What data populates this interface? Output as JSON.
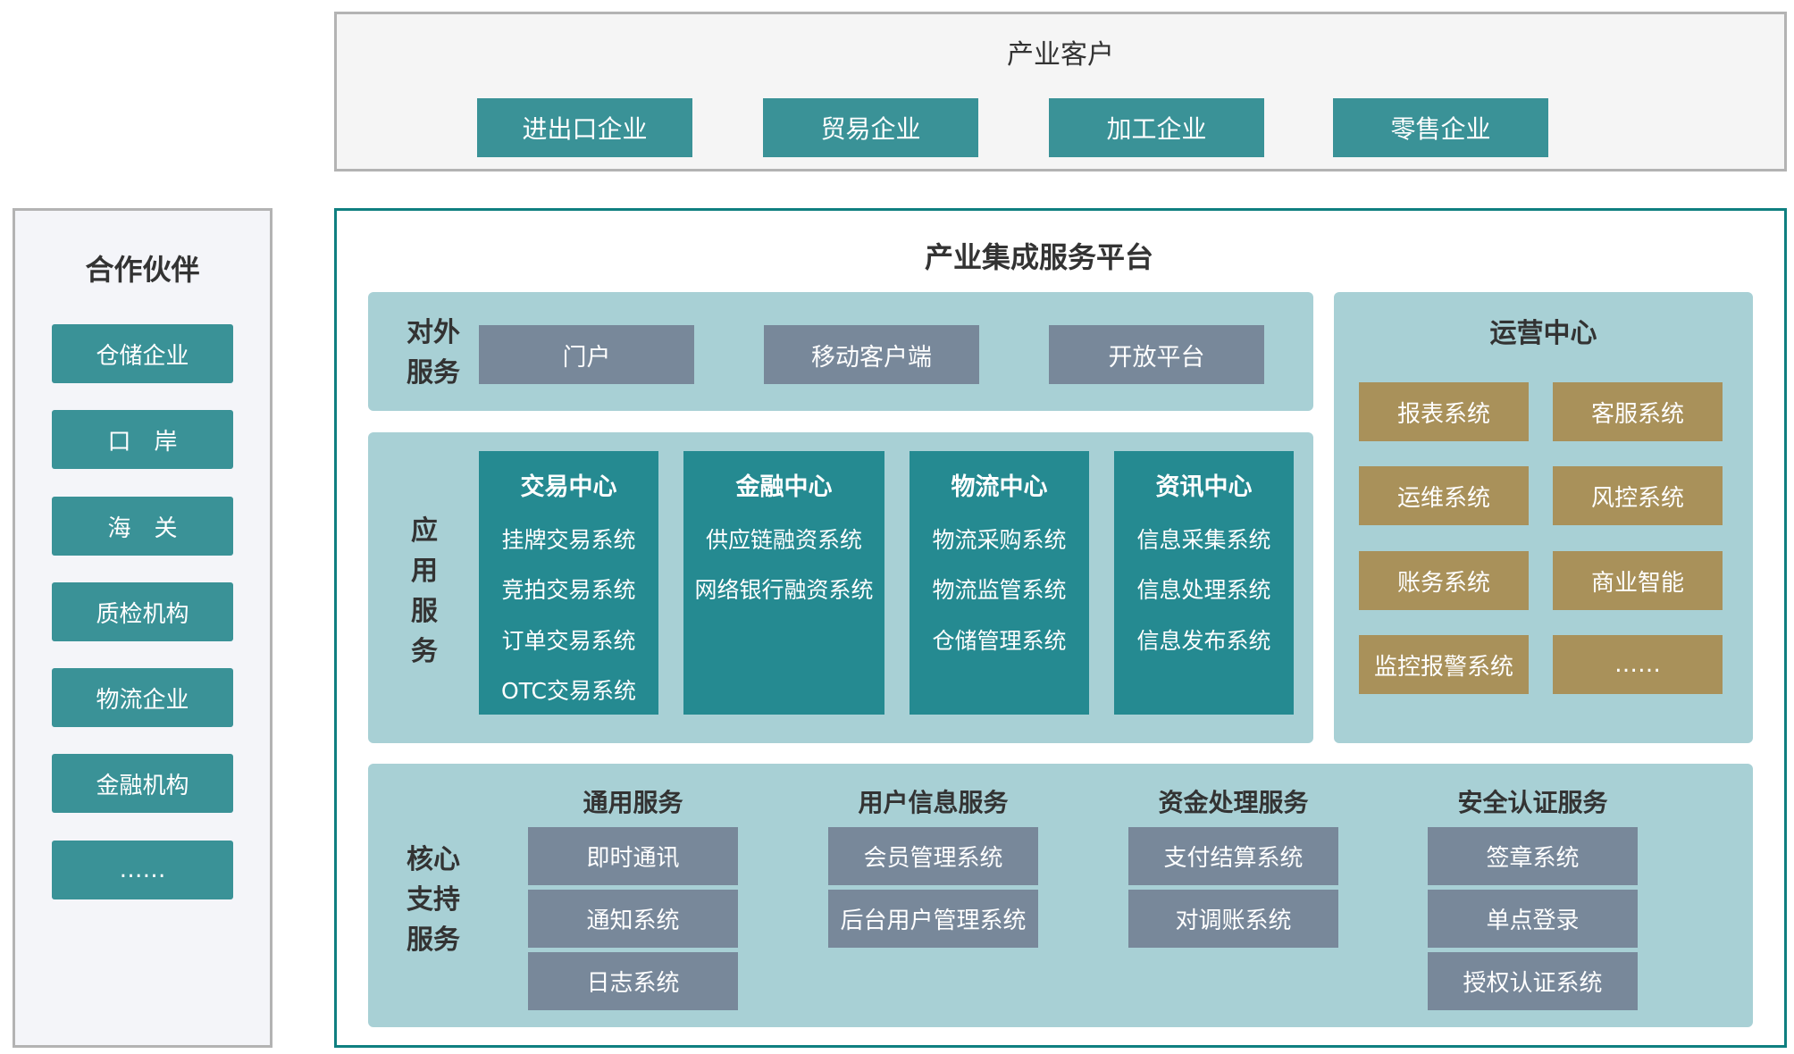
{
  "customers": {
    "title": "产业客户",
    "items": [
      "进出口企业",
      "贸易企业",
      "加工企业",
      "零售企业"
    ]
  },
  "partners": {
    "title": "合作伙伴",
    "items": [
      "仓储企业",
      "口　岸",
      "海　关",
      "质检机构",
      "物流企业",
      "金融机构",
      "……"
    ]
  },
  "platform": {
    "title": "产业集成服务平台",
    "external": {
      "label_line1": "对外",
      "label_line2": "服务",
      "items": [
        "门户",
        "移动客户端",
        "开放平台"
      ]
    },
    "application": {
      "label": [
        "应",
        "用",
        "服",
        "务"
      ],
      "centers": [
        {
          "title": "交易中心",
          "items": [
            "挂牌交易系统",
            "竞拍交易系统",
            "订单交易系统",
            "OTC交易系统"
          ]
        },
        {
          "title": "金融中心",
          "items": [
            "供应链融资系统",
            "网络银行融资系统"
          ]
        },
        {
          "title": "物流中心",
          "items": [
            "物流采购系统",
            "物流监管系统",
            "仓储管理系统"
          ]
        },
        {
          "title": "资讯中心",
          "items": [
            "信息采集系统",
            "信息处理系统",
            "信息发布系统"
          ]
        }
      ]
    },
    "operations": {
      "title": "运营中心",
      "items": [
        "报表系统",
        "客服系统",
        "运维系统",
        "风控系统",
        "账务系统",
        "商业智能",
        "监控报警系统",
        "……"
      ]
    },
    "core": {
      "label": [
        "核心",
        "支持",
        "服务"
      ],
      "groups": [
        {
          "title": "通用服务",
          "items": [
            "即时通讯",
            "通知系统",
            "日志系统"
          ]
        },
        {
          "title": "用户信息服务",
          "items": [
            "会员管理系统",
            "后台用户管理系统"
          ]
        },
        {
          "title": "资金处理服务",
          "items": [
            "支付结算系统",
            "对调账系统"
          ]
        },
        {
          "title": "安全认证服务",
          "items": [
            "签章系统",
            "单点登录",
            "授权认证系统"
          ]
        }
      ]
    }
  },
  "colors": {
    "teal": "#3a9297",
    "dark_teal": "#258a91",
    "panel": "#a8d0d5",
    "gray_box": "#78889a",
    "gold_box": "#a9915a",
    "platform_border": "#0f7f80"
  }
}
